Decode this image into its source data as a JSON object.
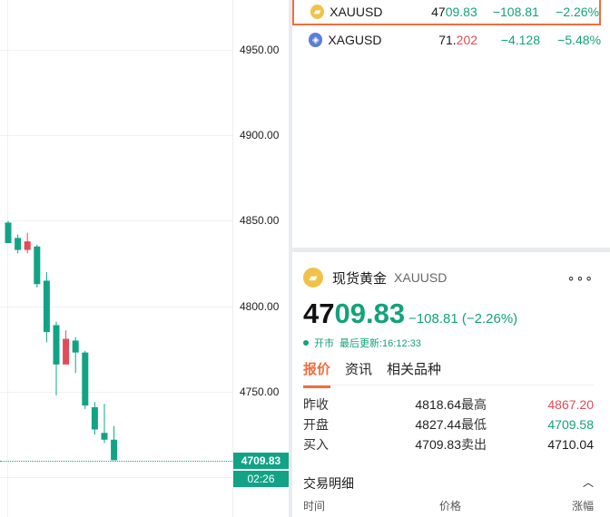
{
  "chart": {
    "axis_labels": [
      "4950.00",
      "4900.00",
      "4850.00",
      "4800.00",
      "4750.00"
    ],
    "current_price": "4709.83",
    "countdown": "02:26",
    "up_color": "#e34b57",
    "down_color": "#12a386",
    "candles": [
      {
        "o": 4849,
        "h": 4850,
        "l": 4838,
        "c": 4837
      },
      {
        "o": 4840,
        "h": 4842,
        "l": 4831,
        "c": 4833
      },
      {
        "o": 4833,
        "h": 4843,
        "l": 4831,
        "c": 4838
      },
      {
        "o": 4835,
        "h": 4836,
        "l": 4811,
        "c": 4813
      },
      {
        "o": 4815,
        "h": 4820,
        "l": 4779,
        "c": 4785
      },
      {
        "o": 4789,
        "h": 4791,
        "l": 4748,
        "c": 4766
      },
      {
        "o": 4766,
        "h": 4786,
        "l": 4766,
        "c": 4781
      },
      {
        "o": 4780,
        "h": 4782,
        "l": 4761,
        "c": 4773
      },
      {
        "o": 4773,
        "h": 4774,
        "l": 4740,
        "c": 4742
      },
      {
        "o": 4741,
        "h": 4744,
        "l": 4725,
        "c": 4728
      },
      {
        "o": 4726,
        "h": 4743,
        "l": 4720,
        "c": 4722
      },
      {
        "o": 4722,
        "h": 4730,
        "l": 4711,
        "c": 4710
      }
    ]
  },
  "watchlist": [
    {
      "symbol": "XAUUSD",
      "icon": "gold-coin-icon",
      "price_head": "47",
      "price_tail": "09.83",
      "tail_color": "green",
      "change": "−108.81",
      "pct": "−2.26%"
    },
    {
      "symbol": "XAGUSD",
      "icon": "silver-coin-icon",
      "price_head": "71.",
      "price_tail": "202",
      "tail_color": "red",
      "change": "−4.128",
      "pct": "−5.48%"
    }
  ],
  "detail": {
    "name_cn": "现货黄金",
    "code": "XAUUSD",
    "more": "∘∘∘",
    "price_head": "47",
    "price_tail": "09.83",
    "change": "−108.81 (−2.26%)",
    "status": "开市",
    "updated": "最后更新:16:12:33",
    "tabs": [
      "报价",
      "资讯",
      "相关品种"
    ],
    "quote": [
      {
        "k1": "昨收",
        "v1": "4818.64",
        "c1": "",
        "k2": "最高",
        "v2": "4867.20",
        "c2": "red"
      },
      {
        "k1": "开盘",
        "v1": "4827.44",
        "c1": "red",
        "k2": "最低",
        "v2": "4709.58",
        "c2": "green"
      },
      {
        "k1": "买入",
        "v1": "4709.83",
        "c1": "",
        "k2": "卖出",
        "v2": "4710.04",
        "c2": ""
      }
    ],
    "trade_title": "交易明细",
    "trade_head": [
      "时间",
      "价格",
      "涨幅"
    ]
  }
}
